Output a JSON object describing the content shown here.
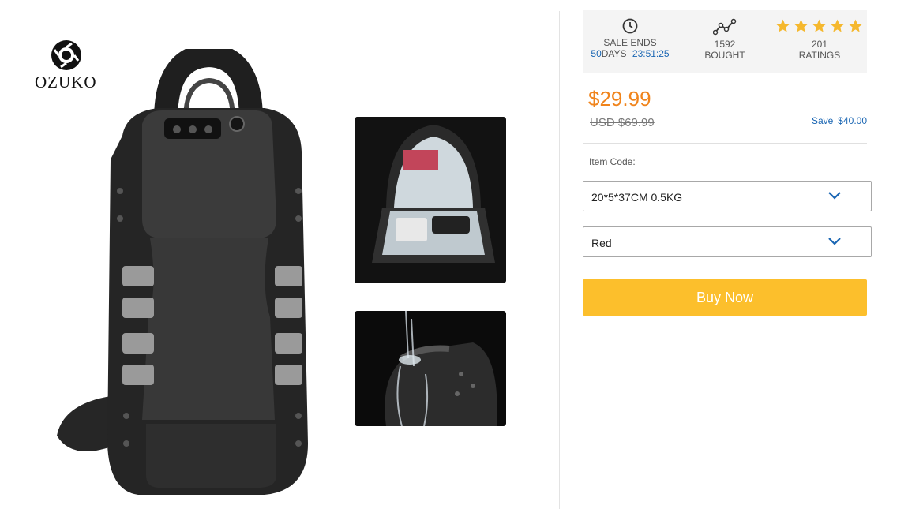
{
  "brand": {
    "name": "OZUKO"
  },
  "gallery": {
    "main_image": "sling-backpack-main",
    "thumbnails": [
      "open-backpack-interior",
      "waterproof-backpack"
    ]
  },
  "stats": {
    "sale": {
      "label": "SALE ENDS",
      "days": "50",
      "days_label": "DAYS",
      "time": "23:51:25",
      "icon": "clock-icon"
    },
    "bought": {
      "count": "1592",
      "label": "BOUGHT",
      "icon": "trend-icon"
    },
    "ratings": {
      "count": "201",
      "label": "RATINGS",
      "stars": 5,
      "icon": "star-icon"
    }
  },
  "pricing": {
    "price": "$29.99",
    "original": "USD $69.99",
    "save_label": "Save",
    "save_amount": "$40.00"
  },
  "options": {
    "item_code_label": "Item Code:",
    "size_value": "20*5*37CM 0.5KG",
    "color_value": "Red"
  },
  "actions": {
    "buy_label": "Buy Now"
  },
  "colors": {
    "accent": "#f0841c",
    "button": "#fcbf2c",
    "link": "#1a66b3",
    "star": "#f5b82e"
  }
}
